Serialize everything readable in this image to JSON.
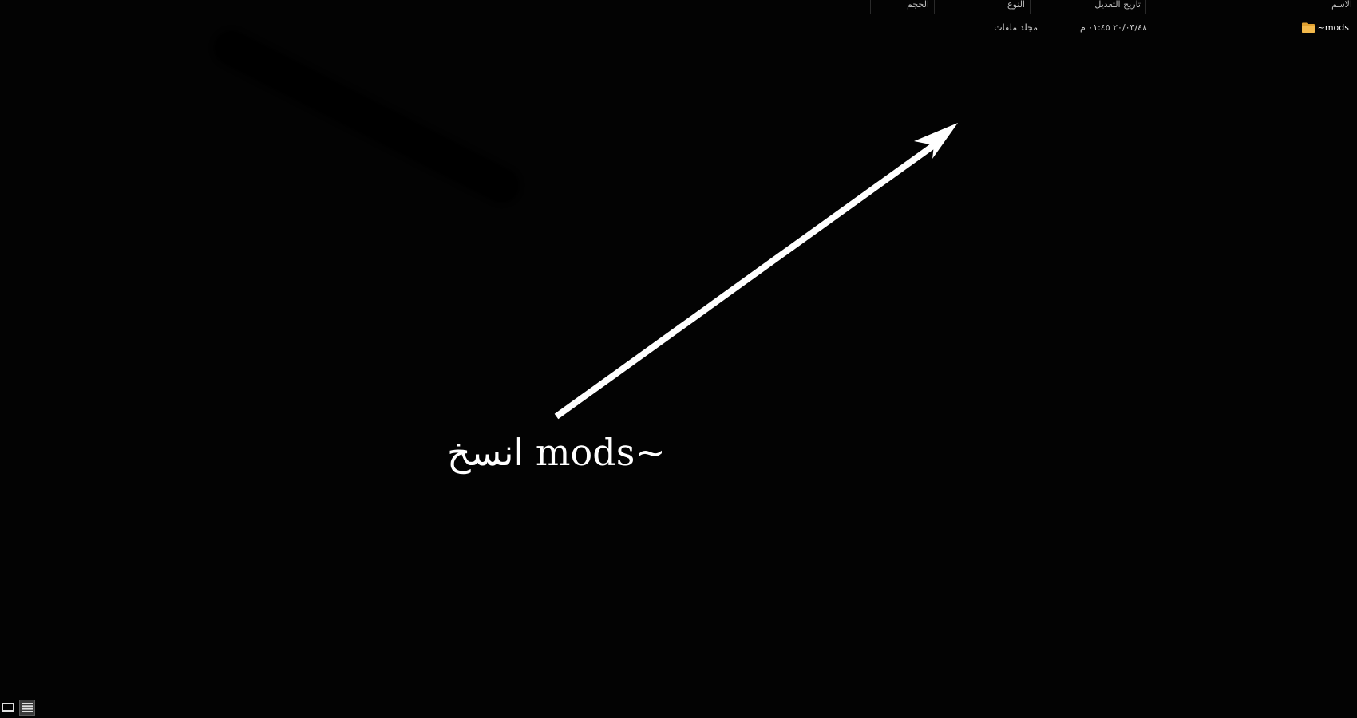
{
  "columns": {
    "name": "الاسم",
    "date_modified": "تاريخ التعديل",
    "type": "النوع",
    "size": "الحجم"
  },
  "files": [
    {
      "name": "mods~",
      "date_modified": "٢٠/٠٣/٤٨ ٠١:٤٥ م",
      "type": "مجلد ملفات",
      "size": "",
      "icon": "folder-icon"
    }
  ],
  "annotation": {
    "text": "انسخ mods~",
    "color": "#ffffff"
  },
  "colors": {
    "background": "#030303",
    "folder": "#f2b84b"
  },
  "view_toggle": {
    "options": [
      "details-view",
      "list-view"
    ],
    "active": "list-view"
  }
}
